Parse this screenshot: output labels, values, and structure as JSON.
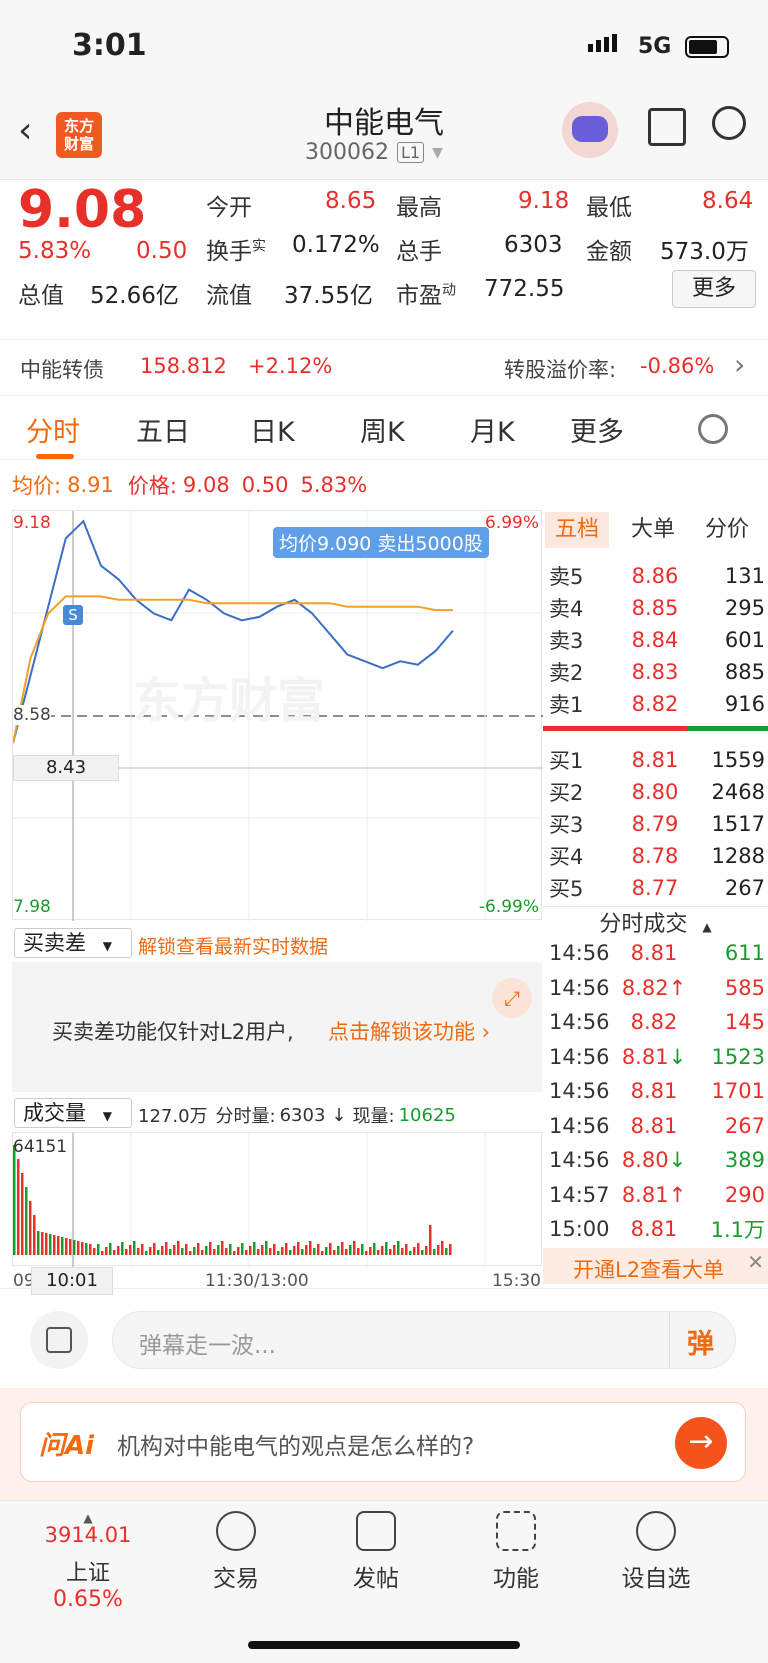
{
  "status": {
    "time": "3:01",
    "network": "5G"
  },
  "header": {
    "logo_line1": "东方",
    "logo_line2": "财富",
    "title": "中能电气",
    "code": "300062",
    "level": "L1"
  },
  "quote": {
    "price": "9.08",
    "change_pct": "5.83%",
    "change": "0.50",
    "open_label": "今开",
    "open": "8.65",
    "high_label": "最高",
    "high": "9.18",
    "low_label": "最低",
    "low": "8.64",
    "turnover_label": "换手",
    "turnover_sup": "实",
    "turnover": "0.172%",
    "volume_label": "总手",
    "volume": "6303",
    "amount_label": "金额",
    "amount": "573.0万",
    "mktcap_label": "总值",
    "mktcap": "52.66亿",
    "float_label": "流值",
    "float": "37.55亿",
    "pe_label": "市盈",
    "pe_sup": "动",
    "pe": "772.55",
    "more": "更多"
  },
  "bond": {
    "name": "中能转债",
    "price": "158.812",
    "pct": "+2.12%",
    "premium_label": "转股溢价率:",
    "premium": "-0.86%"
  },
  "tabs": {
    "t1": "分时",
    "t2": "五日",
    "t3": "日K",
    "t4": "周K",
    "t5": "月K",
    "t6": "更多"
  },
  "info": {
    "avg_label": "均价:",
    "avg": "8.91",
    "price_label": "价格:",
    "price": "9.08",
    "chg": "0.50",
    "pct": "5.83%"
  },
  "chart": {
    "top": "9.18",
    "top_pct": "6.99%",
    "mid": "8.58",
    "bottom": "7.98",
    "bottom_pct": "-6.99%",
    "cross": "8.43",
    "tooltip": "均价9.090 卖出5000股",
    "watermark": "东方财富",
    "s_marker": "S"
  },
  "chart_data": {
    "type": "line",
    "x_labels": [
      "09:30",
      "11:30/13:00",
      "15:30"
    ],
    "ylim": [
      7.98,
      9.18
    ],
    "series": [
      {
        "values": [
          8.5,
          8.7,
          8.9,
          9.1,
          9.15,
          9.02,
          8.98,
          8.92,
          8.88,
          8.86,
          8.95,
          8.92,
          8.88,
          8.86,
          8.87,
          8.9,
          8.92,
          8.88,
          8.82,
          8.76,
          8.74,
          8.72,
          8.74,
          8.73,
          8.77,
          8.83
        ]
      },
      {
        "values": [
          8.5,
          8.75,
          8.88,
          8.93,
          8.93,
          8.93,
          8.92,
          8.92,
          8.92,
          8.92,
          8.92,
          8.91,
          8.91,
          8.91,
          8.91,
          8.91,
          8.91,
          8.91,
          8.91,
          8.9,
          8.9,
          8.9,
          8.9,
          8.9,
          8.89,
          8.89
        ]
      }
    ]
  },
  "orderbook": {
    "tabs": [
      "五档",
      "大单",
      "分价"
    ],
    "asks": [
      {
        "label": "卖5",
        "price": "8.86",
        "vol": "131"
      },
      {
        "label": "卖4",
        "price": "8.85",
        "vol": "295"
      },
      {
        "label": "卖3",
        "price": "8.84",
        "vol": "601"
      },
      {
        "label": "卖2",
        "price": "8.83",
        "vol": "885"
      },
      {
        "label": "卖1",
        "price": "8.82",
        "vol": "916"
      }
    ],
    "bids": [
      {
        "label": "买1",
        "price": "8.81",
        "vol": "1559"
      },
      {
        "label": "买2",
        "price": "8.80",
        "vol": "2468"
      },
      {
        "label": "买3",
        "price": "8.79",
        "vol": "1517"
      },
      {
        "label": "买4",
        "price": "8.78",
        "vol": "1288"
      },
      {
        "label": "买5",
        "price": "8.77",
        "vol": "267"
      }
    ],
    "trades_title": "分时成交",
    "trades": [
      {
        "time": "14:56",
        "price": "8.81",
        "arrow": "",
        "vol": "611",
        "dir": "green"
      },
      {
        "time": "14:56",
        "price": "8.82",
        "arrow": "↑",
        "vol": "585",
        "dir": "red"
      },
      {
        "time": "14:56",
        "price": "8.82",
        "arrow": "",
        "vol": "145",
        "dir": "red"
      },
      {
        "time": "14:56",
        "price": "8.81",
        "arrow": "↓",
        "vol": "1523",
        "dir": "green"
      },
      {
        "time": "14:56",
        "price": "8.81",
        "arrow": "",
        "vol": "1701",
        "dir": "red"
      },
      {
        "time": "14:56",
        "price": "8.81",
        "arrow": "",
        "vol": "267",
        "dir": "red"
      },
      {
        "time": "14:56",
        "price": "8.80",
        "arrow": "↓",
        "vol": "389",
        "dir": "green"
      },
      {
        "time": "14:57",
        "price": "8.81",
        "arrow": "↑",
        "vol": "290",
        "dir": "red"
      },
      {
        "time": "15:00",
        "price": "8.81",
        "arrow": "",
        "vol": "1.1万",
        "dir": "green"
      }
    ],
    "l2_promo": "开通L2查看大单"
  },
  "spread": {
    "select": "买卖差",
    "unlock": "解锁查看最新实时数据",
    "msg": "买卖差功能仅针对L2用户,",
    "cta": "点击解锁该功能"
  },
  "volume": {
    "select": "成交量",
    "total": "127.0万",
    "seg_label": "分时量:",
    "seg": "6303",
    "cur_label": "现量:",
    "cur": "10625",
    "max": "64151",
    "x_left": "09",
    "cursor_time": "10:01",
    "x_mid": "11:30/13:00",
    "x_right": "15:30"
  },
  "comment": {
    "placeholder": "弹幕走一波...",
    "danmu": "弹"
  },
  "ai": {
    "logo": "问Ai",
    "question": "机构对中能电气的观点是怎么样的?"
  },
  "nav": {
    "index_value": "3914.01",
    "index_name": "上证",
    "index_pct": "0.65%",
    "trade": "交易",
    "post": "发帖",
    "func": "功能",
    "watch": "设自选"
  }
}
